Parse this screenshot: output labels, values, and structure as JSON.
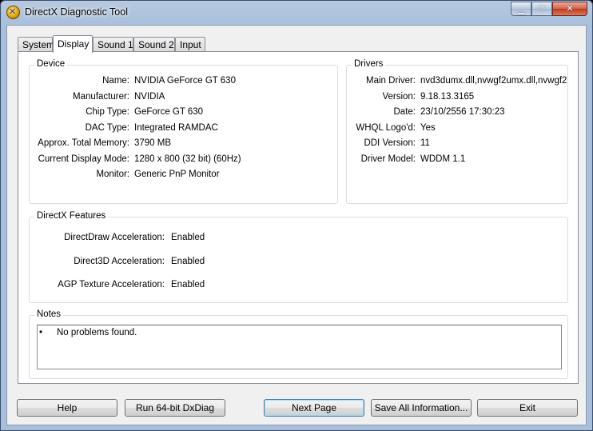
{
  "window": {
    "title": "DirectX Diagnostic Tool"
  },
  "tabs": [
    {
      "label": "System"
    },
    {
      "label": "Display"
    },
    {
      "label": "Sound 1"
    },
    {
      "label": "Sound 2"
    },
    {
      "label": "Input"
    }
  ],
  "device": {
    "heading": "Device",
    "rows": [
      {
        "label": "Name:",
        "value": "NVIDIA GeForce GT 630"
      },
      {
        "label": "Manufacturer:",
        "value": "NVIDIA"
      },
      {
        "label": "Chip Type:",
        "value": "GeForce GT 630"
      },
      {
        "label": "DAC Type:",
        "value": "Integrated RAMDAC"
      },
      {
        "label": "Approx. Total Memory:",
        "value": "3790 MB"
      },
      {
        "label": "Current Display Mode:",
        "value": "1280 x 800 (32 bit) (60Hz)"
      },
      {
        "label": "Monitor:",
        "value": "Generic PnP Monitor"
      }
    ]
  },
  "drivers": {
    "heading": "Drivers",
    "rows": [
      {
        "label": "Main Driver:",
        "value": "nvd3dumx.dll,nvwgf2umx.dll,nvwgf2"
      },
      {
        "label": "Version:",
        "value": "9.18.13.3165"
      },
      {
        "label": "Date:",
        "value": "23/10/2556 17:30:23"
      },
      {
        "label": "WHQL Logo'd:",
        "value": "Yes"
      },
      {
        "label": "DDI Version:",
        "value": "11"
      },
      {
        "label": "Driver Model:",
        "value": "WDDM 1.1"
      }
    ]
  },
  "features": {
    "heading": "DirectX Features",
    "rows": [
      {
        "label": "DirectDraw Acceleration:",
        "value": "Enabled"
      },
      {
        "label": "Direct3D Acceleration:",
        "value": "Enabled"
      },
      {
        "label": "AGP Texture Acceleration:",
        "value": "Enabled"
      }
    ]
  },
  "notes": {
    "heading": "Notes",
    "bullet": "•",
    "items": [
      "No problems found."
    ]
  },
  "buttons": {
    "help": "Help",
    "run64": "Run 64-bit DxDiag",
    "next_page": "Next Page",
    "save_all": "Save All Information...",
    "exit": "Exit"
  },
  "caption_buttons": {
    "minimize": "▁",
    "maximize": "□",
    "close": "✕"
  }
}
